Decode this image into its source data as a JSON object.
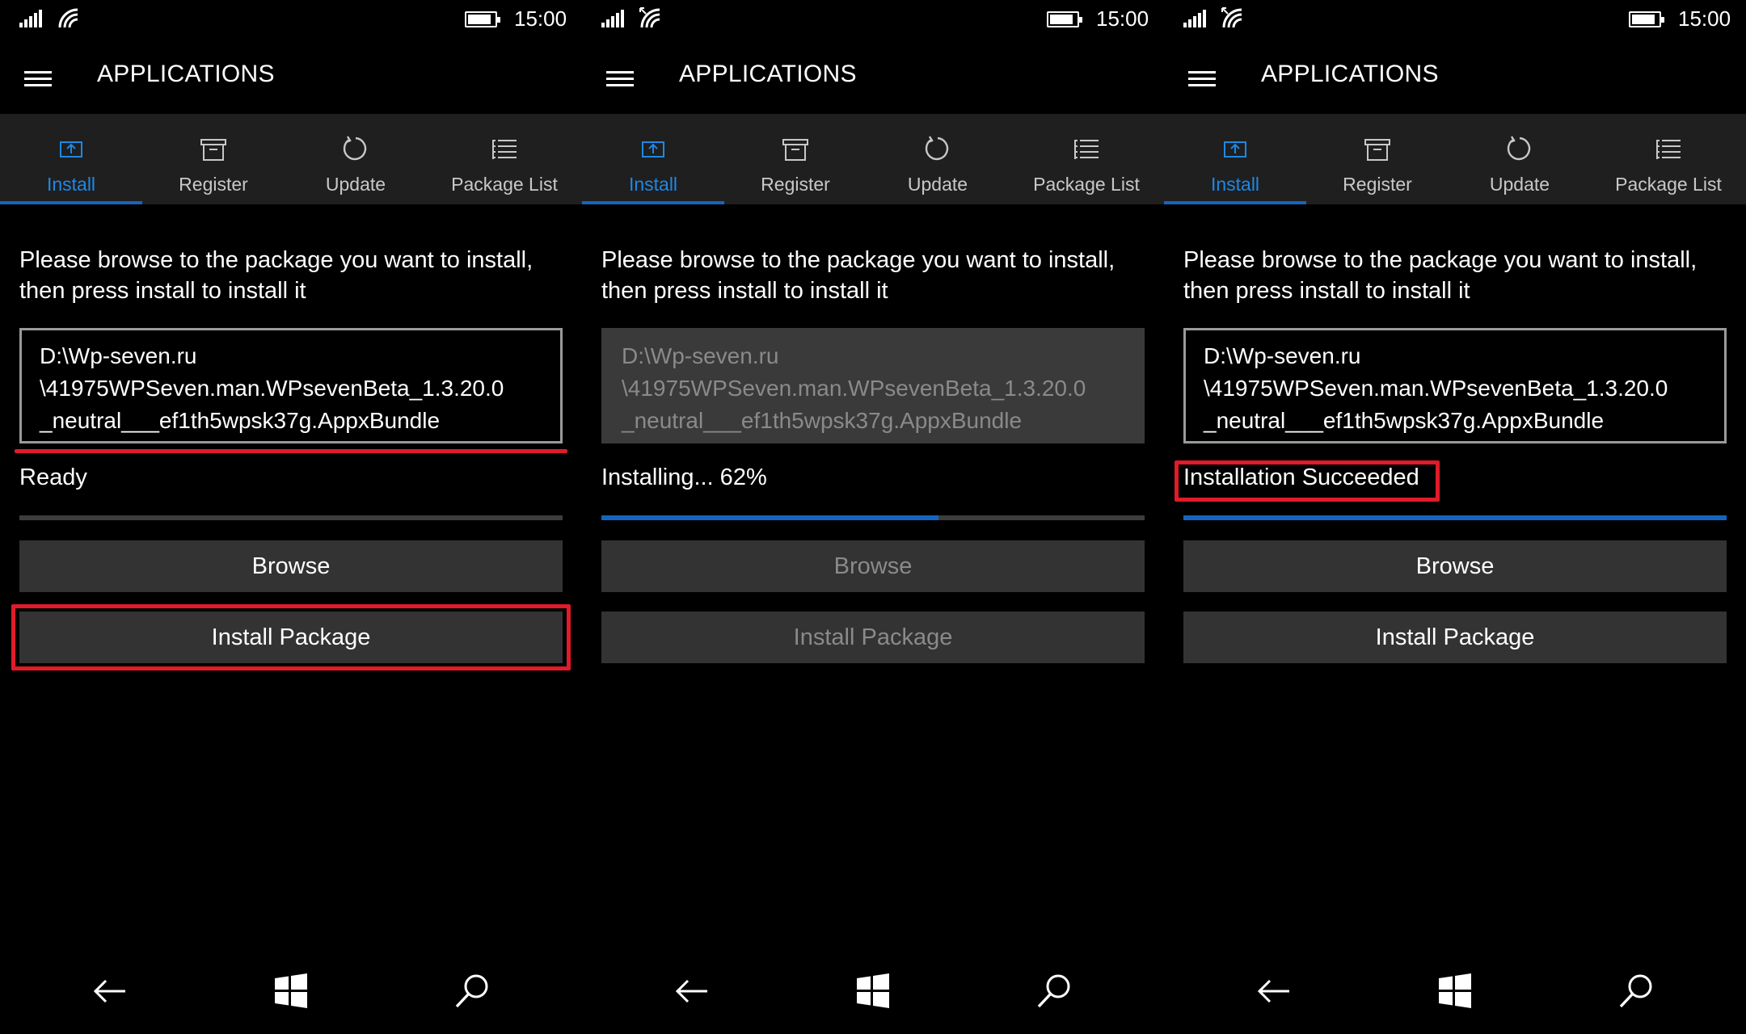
{
  "colors": {
    "accent": "#1565c0",
    "accent_text": "#1e88e5",
    "highlight": "#e01b2a",
    "tabbar": "#1f1f1f",
    "button": "#333333"
  },
  "screens": [
    {
      "time": "15:00",
      "title": "APPLICATIONS",
      "tabs": [
        {
          "label": "Install",
          "icon": "install-icon",
          "active": true
        },
        {
          "label": "Register",
          "icon": "register-icon",
          "active": false
        },
        {
          "label": "Update",
          "icon": "update-icon",
          "active": false
        },
        {
          "label": "Package List",
          "icon": "list-icon",
          "active": false
        }
      ],
      "prompt_line1": "Please browse to the package you want to install,",
      "prompt_line2": "then press install to install it",
      "path": [
        "D:\\Wp-seven.ru",
        "\\41975WPSeven.man.WPsevenBeta_1.3.20.0",
        "_neutral___ef1th5wpsk37g.AppxBundle"
      ],
      "path_enabled": true,
      "status": "Ready",
      "progress": 0,
      "browse_label": "Browse",
      "install_label": "Install Package",
      "buttons_enabled": true
    },
    {
      "time": "15:00",
      "title": "APPLICATIONS",
      "tabs": [
        {
          "label": "Install",
          "icon": "install-icon",
          "active": true
        },
        {
          "label": "Register",
          "icon": "register-icon",
          "active": false
        },
        {
          "label": "Update",
          "icon": "update-icon",
          "active": false
        },
        {
          "label": "Package List",
          "icon": "list-icon",
          "active": false
        }
      ],
      "prompt_line1": "Please browse to the package you want to install,",
      "prompt_line2": "then press install to install it",
      "path": [
        "D:\\Wp-seven.ru",
        "\\41975WPSeven.man.WPsevenBeta_1.3.20.0",
        "_neutral___ef1th5wpsk37g.AppxBundle"
      ],
      "path_enabled": false,
      "status": "Installing... 62%",
      "progress": 0.62,
      "browse_label": "Browse",
      "install_label": "Install Package",
      "buttons_enabled": false
    },
    {
      "time": "15:00",
      "title": "APPLICATIONS",
      "tabs": [
        {
          "label": "Install",
          "icon": "install-icon",
          "active": true
        },
        {
          "label": "Register",
          "icon": "register-icon",
          "active": false
        },
        {
          "label": "Update",
          "icon": "update-icon",
          "active": false
        },
        {
          "label": "Package List",
          "icon": "list-icon",
          "active": false
        }
      ],
      "prompt_line1": "Please browse to the package you want to install,",
      "prompt_line2": "then press install to install it",
      "path": [
        "D:\\Wp-seven.ru",
        "\\41975WPSeven.man.WPsevenBeta_1.3.20.0",
        "_neutral___ef1th5wpsk37g.AppxBundle"
      ],
      "path_enabled": true,
      "status": "Installation Succeeded",
      "progress": 1,
      "browse_label": "Browse",
      "install_label": "Install Package",
      "buttons_enabled": true
    }
  ]
}
